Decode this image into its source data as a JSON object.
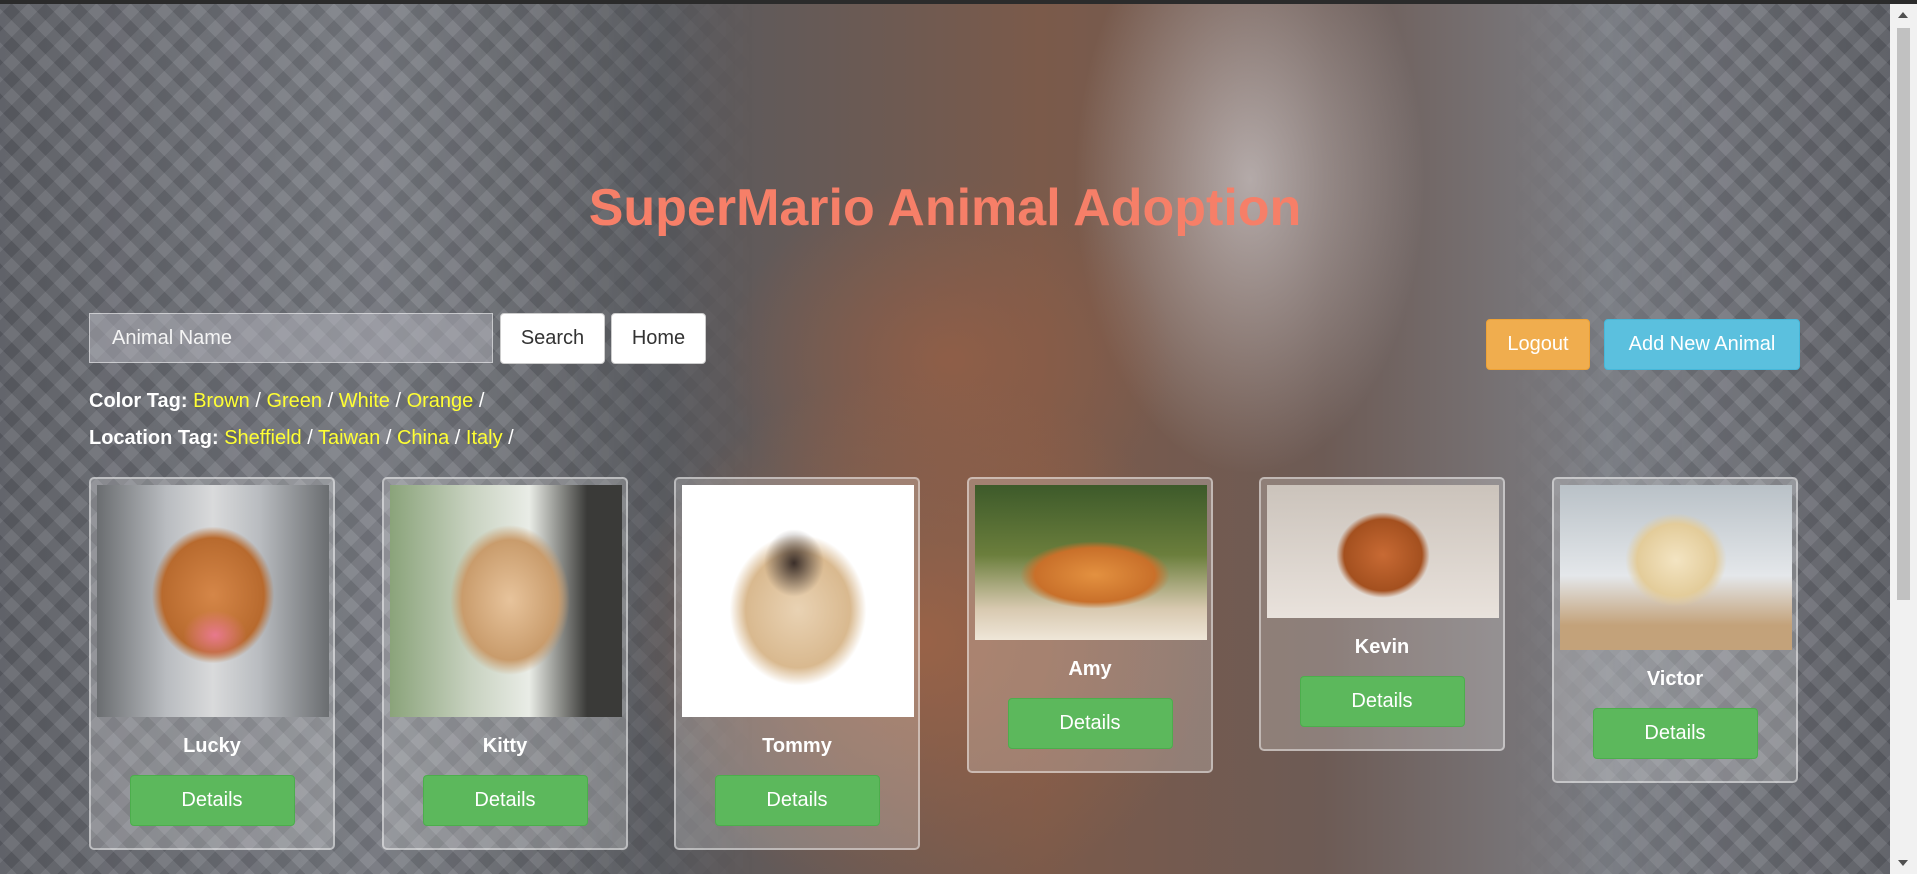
{
  "header": {
    "title": "SuperMario Animal Adoption"
  },
  "search": {
    "placeholder": "Animal Name",
    "search_label": "Search",
    "home_label": "Home"
  },
  "actions": {
    "logout_label": "Logout",
    "add_label": "Add New Animal"
  },
  "color_tags": {
    "label": "Color Tag:",
    "items": [
      "Brown",
      "Green",
      "White",
      "Orange"
    ]
  },
  "location_tags": {
    "label": "Location Tag:",
    "items": [
      "Sheffield",
      "Taiwan",
      "China",
      "Italy"
    ]
  },
  "separator": "/",
  "animals": [
    {
      "name": "Lucky",
      "details_label": "Details"
    },
    {
      "name": "Kitty",
      "details_label": "Details"
    },
    {
      "name": "Tommy",
      "details_label": "Details"
    },
    {
      "name": "Amy",
      "details_label": "Details"
    },
    {
      "name": "Kevin",
      "details_label": "Details"
    },
    {
      "name": "Victor",
      "details_label": "Details"
    }
  ],
  "colors": {
    "title": "#f67f68",
    "tag_link": "#ffff33",
    "details": "#5cb85c",
    "logout": "#f0ad4e",
    "add": "#5bc0de"
  }
}
